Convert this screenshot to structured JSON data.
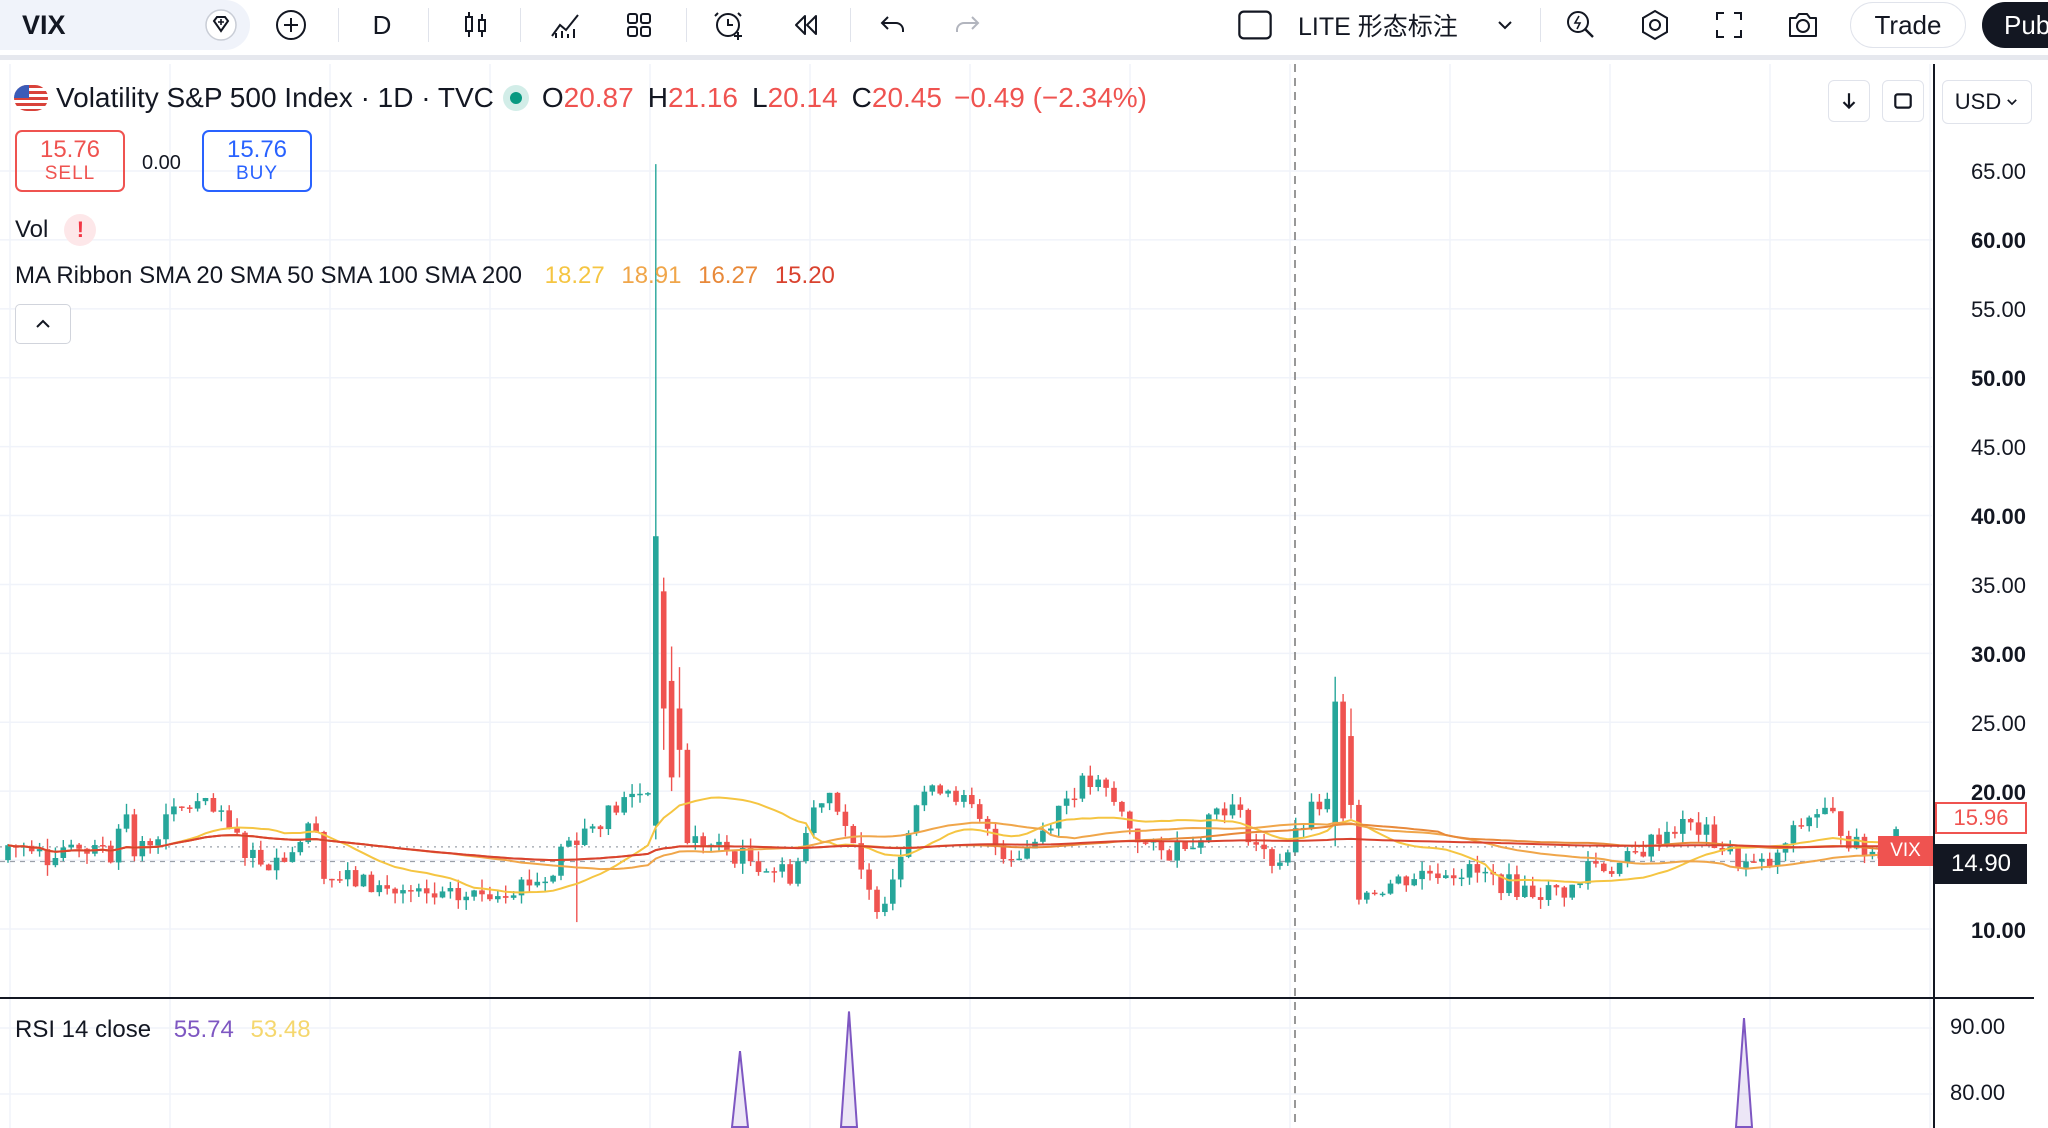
{
  "toolbar": {
    "symbol": "VIX",
    "interval": "D",
    "pattern_toggle_label": "LITE 形态标注",
    "trade_label": "Trade",
    "publish_label": "Pub"
  },
  "legend": {
    "title": "Volatility S&P 500 Index · 1D · TVC",
    "o_key": "O",
    "o_val": "20.87",
    "h_key": "H",
    "h_val": "21.16",
    "l_key": "L",
    "l_val": "20.14",
    "c_key": "C",
    "c_val": "20.45",
    "change": "−0.49 (−2.34%)"
  },
  "trade": {
    "sell_price": "15.76",
    "sell_label": "SELL",
    "spread": "0.00",
    "buy_price": "15.76",
    "buy_label": "BUY"
  },
  "indicators": {
    "vol_label": "Vol",
    "vol_warning": "!",
    "ma_label": "MA Ribbon SMA 20 SMA 50 SMA 100 SMA 200",
    "ma_values": [
      "18.27",
      "18.91",
      "16.27",
      "15.20"
    ],
    "rsi_label": "RSI 14 close",
    "rsi_value": "55.74",
    "rsi_ma_value": "53.48"
  },
  "price_axis": {
    "currency": "USD",
    "labels": [
      "65.00",
      "60.00",
      "55.00",
      "50.00",
      "45.00",
      "40.00",
      "35.00",
      "30.00",
      "25.00",
      "20.00",
      "15.96",
      "14.90",
      "10.00"
    ],
    "current_price": "14.90",
    "prev_close_tag": "15.96",
    "symbol_tag": "VIX"
  },
  "rsi_axis": {
    "labels": [
      "90.00",
      "80.00"
    ]
  },
  "colors": {
    "up": "#26a69a",
    "down": "#ef5350",
    "sma20": "#f5c542",
    "sma50": "#f0a64a",
    "sma100": "#e8893a",
    "sma200": "#d9422f",
    "rsi": "#7e57c2"
  },
  "chart_data": {
    "type": "candlestick",
    "price_range": [
      5,
      68
    ],
    "grid": true,
    "spikes": [
      {
        "label": "main",
        "high": 65.5,
        "close": 38.5
      },
      {
        "label": "right",
        "high": 28.3,
        "close": 17.5
      }
    ],
    "sma": [
      {
        "name": "SMA 20",
        "last": 18.27
      },
      {
        "name": "SMA 50",
        "last": 18.91
      },
      {
        "name": "SMA 100",
        "last": 16.27
      },
      {
        "name": "SMA 200",
        "last": 15.2
      }
    ],
    "rsi_range": [
      75,
      95
    ]
  }
}
